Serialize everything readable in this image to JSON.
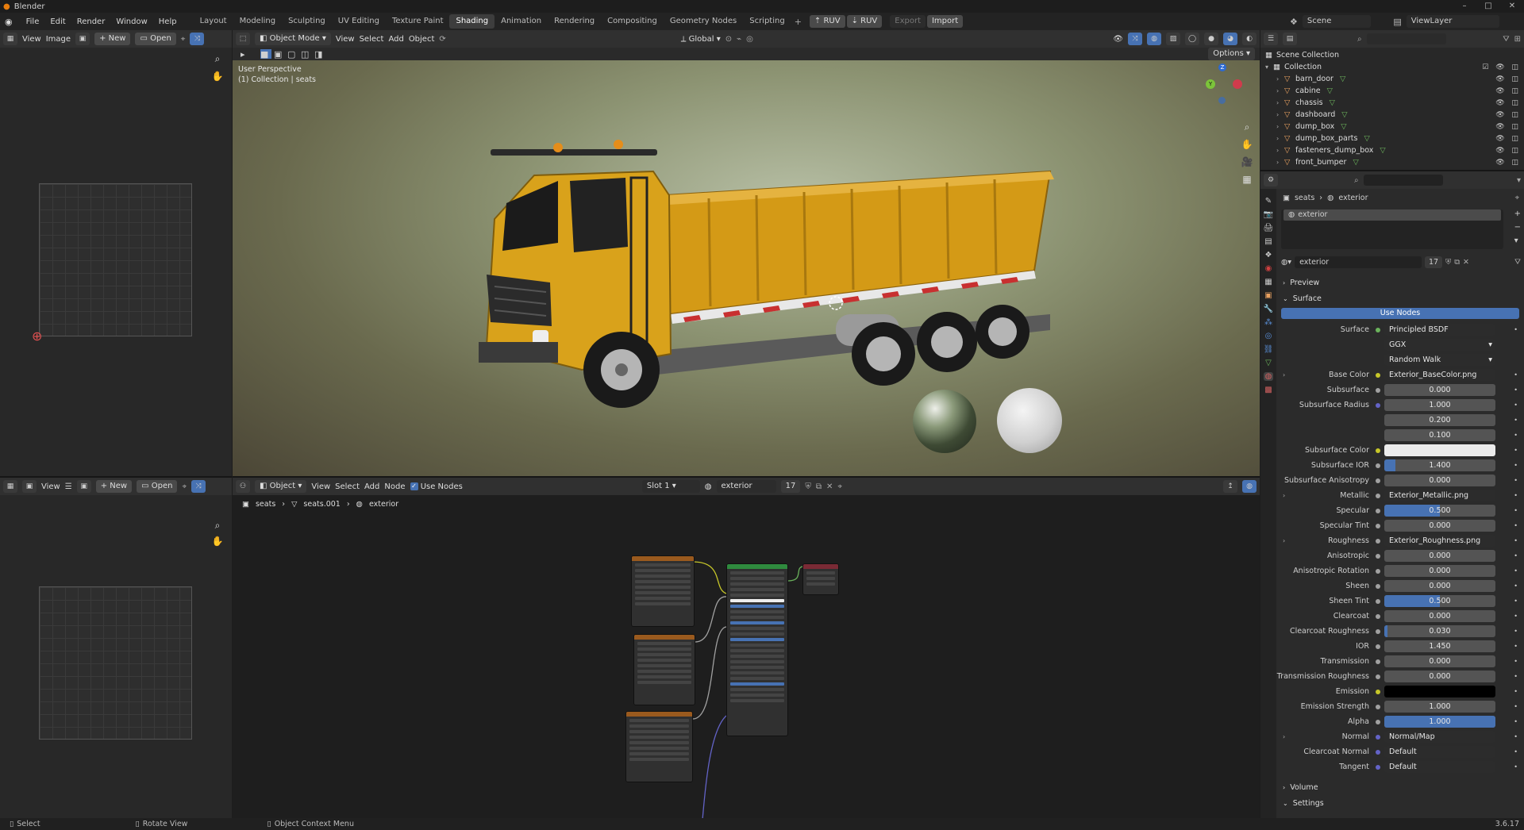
{
  "window": {
    "title": "Blender",
    "version": "3.6.17"
  },
  "menu": [
    "File",
    "Edit",
    "Render",
    "Window",
    "Help"
  ],
  "workspaces": [
    "Layout",
    "Modeling",
    "Sculpting",
    "UV Editing",
    "Texture Paint",
    "Shading",
    "Animation",
    "Rendering",
    "Compositing",
    "Geometry Nodes",
    "Scripting"
  ],
  "active_workspace": "Shading",
  "top_buttons": {
    "ruv1": "RUV",
    "ruv2": "RUV",
    "export": "Export",
    "import": "Import"
  },
  "scene": {
    "name": "Scene",
    "view_layer": "ViewLayer"
  },
  "image_editor_top": {
    "view": "View",
    "image": "Image",
    "new": "New",
    "open": "Open"
  },
  "image_editor_bottom": {
    "view": "View",
    "new": "New",
    "open": "Open"
  },
  "viewport": {
    "mode": "Object Mode",
    "menus": [
      "View",
      "Select",
      "Add",
      "Object"
    ],
    "transform": "Global",
    "options": "Options",
    "overlay_title": "User Perspective",
    "overlay_sub": "(1) Collection | seats",
    "gizmo": {
      "z": "Z",
      "y": "Y"
    }
  },
  "outliner": {
    "root": "Scene Collection",
    "collection": "Collection",
    "items": [
      "barn_door",
      "cabine",
      "chassis",
      "dashboard",
      "dump_box",
      "dump_box_parts",
      "fasteners_dump_box",
      "front_bumper"
    ]
  },
  "node_editor": {
    "object": "Object",
    "menus": [
      "View",
      "Select",
      "Add",
      "Node"
    ],
    "use_nodes": "Use Nodes",
    "slot": "Slot 1",
    "material": "exterior",
    "users": "17",
    "breadcrumb": [
      "seats",
      "seats.001",
      "exterior"
    ]
  },
  "properties": {
    "breadcrumb": [
      "seats",
      "exterior"
    ],
    "slot_item": "exterior",
    "material": "exterior",
    "users": "17",
    "sections": {
      "preview": "Preview",
      "surface": "Surface",
      "volume": "Volume",
      "settings": "Settings"
    },
    "use_nodes": "Use Nodes",
    "rows": [
      {
        "label": "Surface",
        "value": "Principled BSDF",
        "kind": "link",
        "dot": "#6bb35c"
      },
      {
        "label": "",
        "value": "GGX",
        "kind": "enum"
      },
      {
        "label": "",
        "value": "Random Walk",
        "kind": "enum"
      },
      {
        "label": "Base Color",
        "value": "Exterior_BaseColor.png",
        "kind": "link",
        "dot": "#c7c729",
        "expand": true
      },
      {
        "label": "Subsurface",
        "value": "0.000",
        "kind": "num",
        "dot": "#a1a1a1"
      },
      {
        "label": "Subsurface Radius",
        "value": "1.000",
        "kind": "num",
        "dot": "#6363c7"
      },
      {
        "label": "",
        "value": "0.200",
        "kind": "num"
      },
      {
        "label": "",
        "value": "0.100",
        "kind": "num"
      },
      {
        "label": "Subsurface Color",
        "value": "",
        "kind": "color",
        "color": "#ececec",
        "dot": "#c7c729"
      },
      {
        "label": "Subsurface IOR",
        "value": "1.400",
        "kind": "num",
        "fill": 0.1,
        "dot": "#a1a1a1"
      },
      {
        "label": "Subsurface Anisotropy",
        "value": "0.000",
        "kind": "num",
        "dot": "#a1a1a1"
      },
      {
        "label": "Metallic",
        "value": "Exterior_Metallic.png",
        "kind": "link",
        "dot": "#a1a1a1",
        "expand": true
      },
      {
        "label": "Specular",
        "value": "0.500",
        "kind": "num",
        "fill": 0.5,
        "dot": "#a1a1a1"
      },
      {
        "label": "Specular Tint",
        "value": "0.000",
        "kind": "num",
        "dot": "#a1a1a1"
      },
      {
        "label": "Roughness",
        "value": "Exterior_Roughness.png",
        "kind": "link",
        "dot": "#a1a1a1",
        "expand": true
      },
      {
        "label": "Anisotropic",
        "value": "0.000",
        "kind": "num",
        "dot": "#a1a1a1"
      },
      {
        "label": "Anisotropic Rotation",
        "value": "0.000",
        "kind": "num",
        "dot": "#a1a1a1"
      },
      {
        "label": "Sheen",
        "value": "0.000",
        "kind": "num",
        "dot": "#a1a1a1"
      },
      {
        "label": "Sheen Tint",
        "value": "0.500",
        "kind": "num",
        "fill": 0.5,
        "dot": "#a1a1a1"
      },
      {
        "label": "Clearcoat",
        "value": "0.000",
        "kind": "num",
        "dot": "#a1a1a1"
      },
      {
        "label": "Clearcoat Roughness",
        "value": "0.030",
        "kind": "num",
        "fill": 0.03,
        "dot": "#a1a1a1"
      },
      {
        "label": "IOR",
        "value": "1.450",
        "kind": "num",
        "dot": "#a1a1a1"
      },
      {
        "label": "Transmission",
        "value": "0.000",
        "kind": "num",
        "dot": "#a1a1a1"
      },
      {
        "label": "Transmission Roughness",
        "value": "0.000",
        "kind": "num",
        "dot": "#a1a1a1"
      },
      {
        "label": "Emission",
        "value": "",
        "kind": "color",
        "color": "#000000",
        "dot": "#c7c729"
      },
      {
        "label": "Emission Strength",
        "value": "1.000",
        "kind": "num",
        "dot": "#a1a1a1"
      },
      {
        "label": "Alpha",
        "value": "1.000",
        "kind": "num",
        "fill": 1.0,
        "dot": "#a1a1a1"
      },
      {
        "label": "Normal",
        "value": "Normal/Map",
        "kind": "link",
        "dot": "#6363c7",
        "expand": true
      },
      {
        "label": "Clearcoat Normal",
        "value": "Default",
        "kind": "link",
        "dot": "#6363c7"
      },
      {
        "label": "Tangent",
        "value": "Default",
        "kind": "link",
        "dot": "#6363c7"
      }
    ]
  },
  "status": {
    "select": "Select",
    "rotate": "Rotate View",
    "context": "Object Context Menu"
  },
  "colors": {
    "accent": "#4772b3",
    "truck_yellow": "#d9a21b",
    "header": "#303030",
    "panel": "#282828"
  }
}
